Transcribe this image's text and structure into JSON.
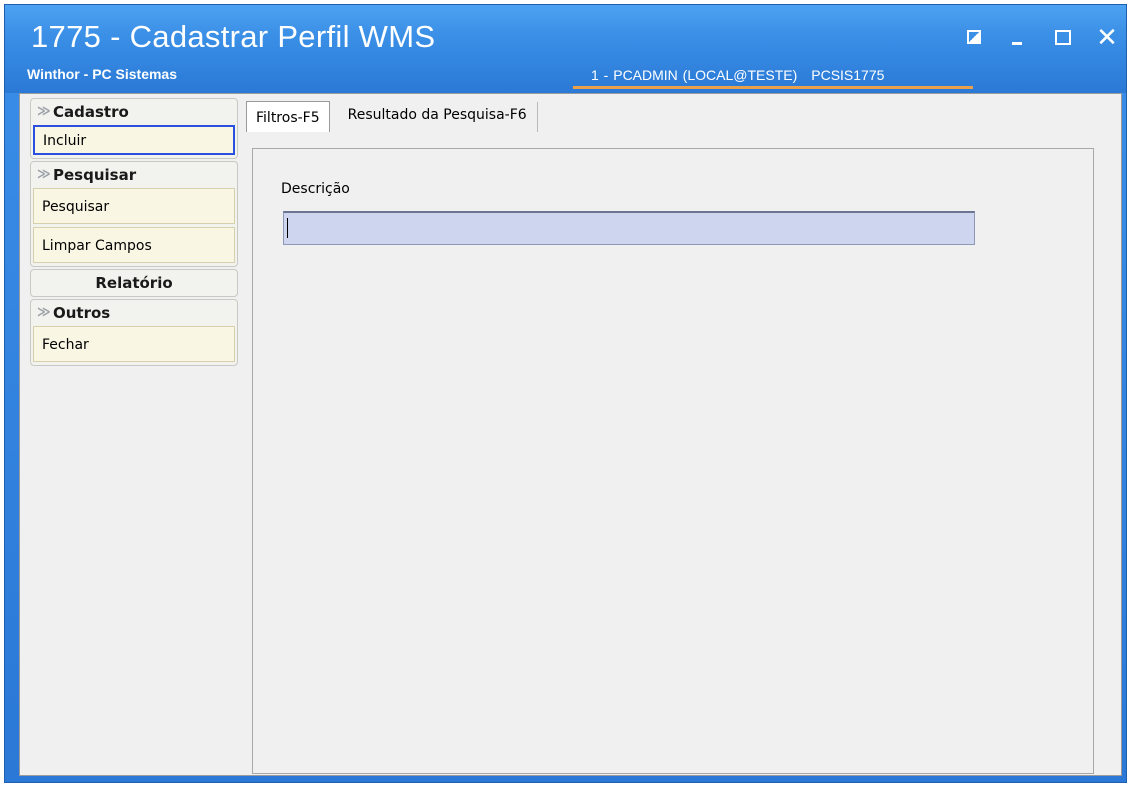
{
  "window": {
    "title": "1775 - Cadastrar Perfil WMS",
    "subtitle": "Winthor - PC Sistemas",
    "user": "1 - PCADMIN (LOCAL@TESTE)",
    "routine_code": "PCSIS1775",
    "icons": [
      "restore-icon",
      "minimize-icon",
      "maximize-icon",
      "close-icon"
    ],
    "close_glyph": "✕"
  },
  "sidebar": {
    "groups": [
      {
        "label": "Cadastro",
        "collapsible": true,
        "items": [
          {
            "label": "Incluir",
            "selected": true
          }
        ]
      },
      {
        "label": "Pesquisar",
        "collapsible": true,
        "items": [
          {
            "label": "Pesquisar"
          },
          {
            "label": "Limpar Campos"
          }
        ]
      },
      {
        "label": "Relatório",
        "collapsible": false,
        "items": []
      },
      {
        "label": "Outros",
        "collapsible": true,
        "items": [
          {
            "label": "Fechar"
          }
        ]
      }
    ],
    "chevron_glyph": "≫"
  },
  "tabs": [
    {
      "label": "Filtros-F5",
      "active": true
    },
    {
      "label": "Resultado da Pesquisa-F6",
      "active": false
    }
  ],
  "filters": {
    "descricao_label": "Descrição",
    "descricao_value": ""
  },
  "colors": {
    "titlebar": "#2a79d6",
    "accent_line": "#e8a04a",
    "selected_border": "#2a50e0",
    "input_bg": "#cdd6ee"
  }
}
